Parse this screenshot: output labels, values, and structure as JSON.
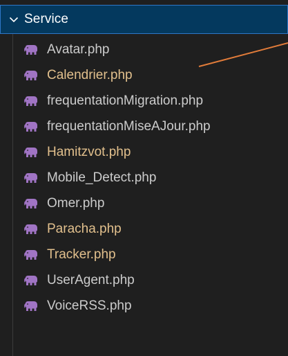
{
  "folder": {
    "label": "Service",
    "expanded": true,
    "icon": "chevron-down-icon"
  },
  "colors": {
    "background": "#1f1f1f",
    "folder_highlight": "#04395e",
    "folder_border": "#2f77c7",
    "unmodified_text": "#cccccc",
    "modified_text": "#e2c08d",
    "php_icon": "#a074c4",
    "annotation": "#e27c3a"
  },
  "files": [
    {
      "name": "Avatar.php",
      "modified": false,
      "icon": "php-elephant-icon"
    },
    {
      "name": "Calendrier.php",
      "modified": true,
      "icon": "php-elephant-icon"
    },
    {
      "name": "frequentationMigration.php",
      "modified": false,
      "icon": "php-elephant-icon"
    },
    {
      "name": "frequentationMiseAJour.php",
      "modified": false,
      "icon": "php-elephant-icon"
    },
    {
      "name": "Hamitzvot.php",
      "modified": true,
      "icon": "php-elephant-icon"
    },
    {
      "name": "Mobile_Detect.php",
      "modified": false,
      "icon": "php-elephant-icon"
    },
    {
      "name": "Omer.php",
      "modified": false,
      "icon": "php-elephant-icon"
    },
    {
      "name": "Paracha.php",
      "modified": true,
      "icon": "php-elephant-icon"
    },
    {
      "name": "Tracker.php",
      "modified": true,
      "icon": "php-elephant-icon"
    },
    {
      "name": "UserAgent.php",
      "modified": false,
      "icon": "php-elephant-icon"
    },
    {
      "name": "VoiceRSS.php",
      "modified": false,
      "icon": "php-elephant-icon"
    }
  ]
}
